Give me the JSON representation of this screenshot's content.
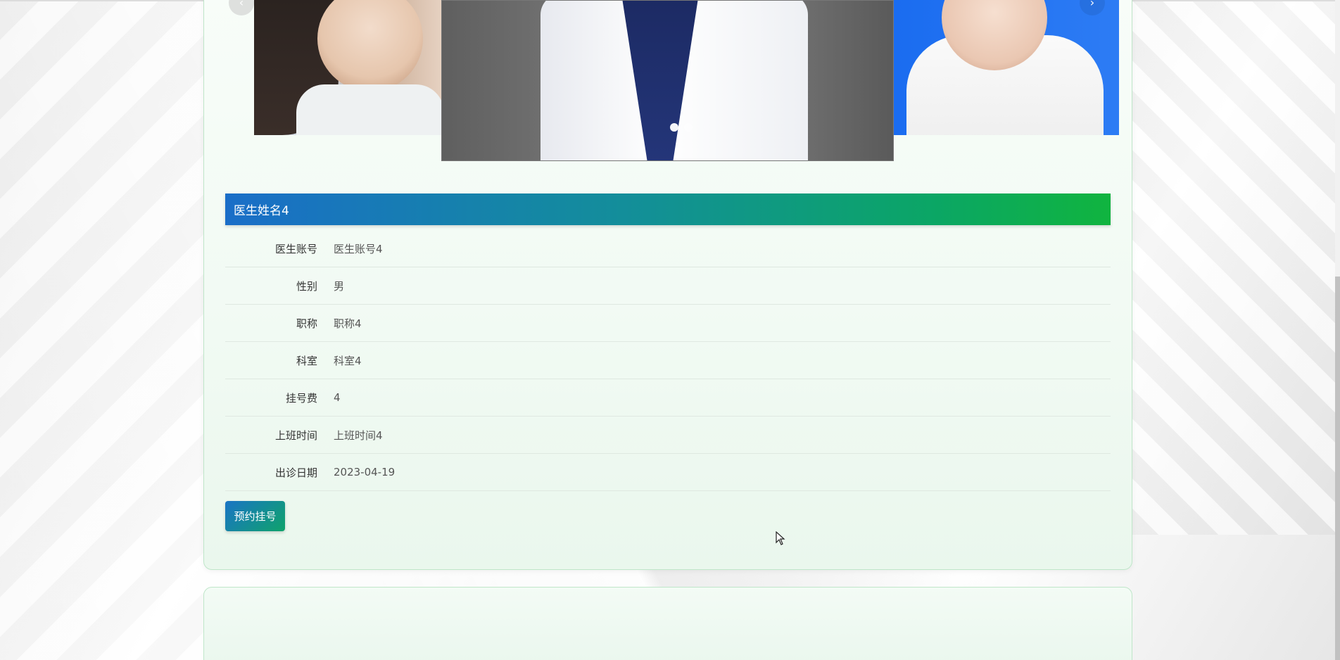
{
  "carousel": {
    "prev_icon": "‹",
    "next_icon": "›"
  },
  "doctor": {
    "name": "医生姓名4",
    "fields": [
      {
        "label": "医生账号",
        "value": "医生账号4"
      },
      {
        "label": "性别",
        "value": "男"
      },
      {
        "label": "职称",
        "value": "职称4"
      },
      {
        "label": "科室",
        "value": "科室4"
      },
      {
        "label": "挂号费",
        "value": "4"
      },
      {
        "label": "上班时间",
        "value": "上班时间4"
      },
      {
        "label": "出诊日期",
        "value": "2023-04-19"
      }
    ]
  },
  "actions": {
    "book_label": "预约挂号"
  },
  "colors": {
    "header_gradient_start": "#1a6ec8",
    "header_gradient_end": "#10b43f",
    "card_border": "#bfe6c9"
  }
}
